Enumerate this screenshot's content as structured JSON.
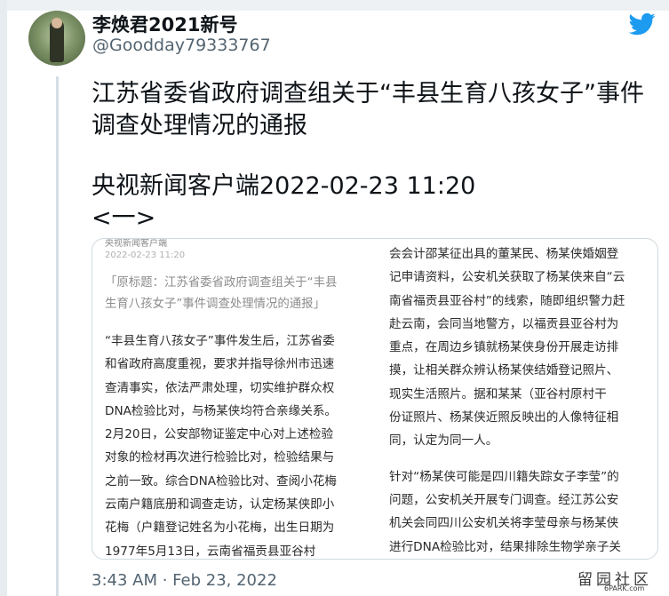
{
  "tweet": {
    "author_name": "李焕君2021新号",
    "author_handle": "@Goodday79333767",
    "lines": [
      "江苏省委省政府调查组关于“丰县生育八孩女子”事件",
      "调查处理情况的通报"
    ],
    "source_line": "央视新闻客户端2022-02-23 11:20",
    "section": "<一>",
    "timestamp": "3:43 AM · Feb 23, 2022"
  },
  "card": {
    "source": "央视新闻客户端",
    "date": "2022-02-23 11:20",
    "quote_lines": [
      "「原标题：江苏省委省政府调查组关于“丰县",
      "生育八孩女子”事件调查处理情况的通报」"
    ],
    "left_lines_1": [
      "“丰县生育八孩女子”事件发生后，江苏省委",
      "和省政府高度重视，要求并指导徐州市迅速",
      "查清事实，依法严肃处理，切实维护群众权",
      "DNA检验比对，与杨某侠均符合亲缘关系。",
      "2月20日，公安部物证鉴定中心对上述检验",
      "对象的检材再次进行检验比对，检验结果与",
      "之前一致。综合DNA检验比对、查阅小花梅",
      "云南户籍底册和调查走访，认定杨某侠即小",
      "花梅（户籍登记姓名为小花梅，出生日期为",
      "1977年5月13日，云南省福贡县亚谷村"
    ],
    "right_lines_1": [
      "会会计邵某征出具的董某民、杨某侠婚姻登",
      "记申请资料，公安机关获取了杨某侠来自“云",
      "南省福贡县亚谷村”的线索，随即组织警力赶",
      "赴云南，会同当地警方，以福贡县亚谷村为",
      "重点，在周边乡镇就杨某侠身份开展走访排",
      "摸，让相关群众辨认杨某侠结婚登记照片、",
      "现实生活照片。据和某某（亚谷村原村干",
      "份证照片、杨某侠近照反映出的人像特征相",
      "同，认定为同一人。"
    ],
    "right_lines_2": [
      "针对“杨某侠可能是四川籍失踪女子李莹”的",
      "问题，公安机关开展专门调查。经江苏公安",
      "机关会同四川公安机关将李莹母亲与杨某侠",
      "进行DNA检验比对，结果排除生物学亲子关"
    ]
  },
  "watermark": {
    "text": "留园社区",
    "site": "6PARK.com"
  },
  "colors": {
    "accent": "#1d9bf0",
    "text": "#0f1419",
    "muted": "#536471",
    "border": "#cfd9de"
  },
  "icons": [
    "twitter-bird-icon"
  ]
}
